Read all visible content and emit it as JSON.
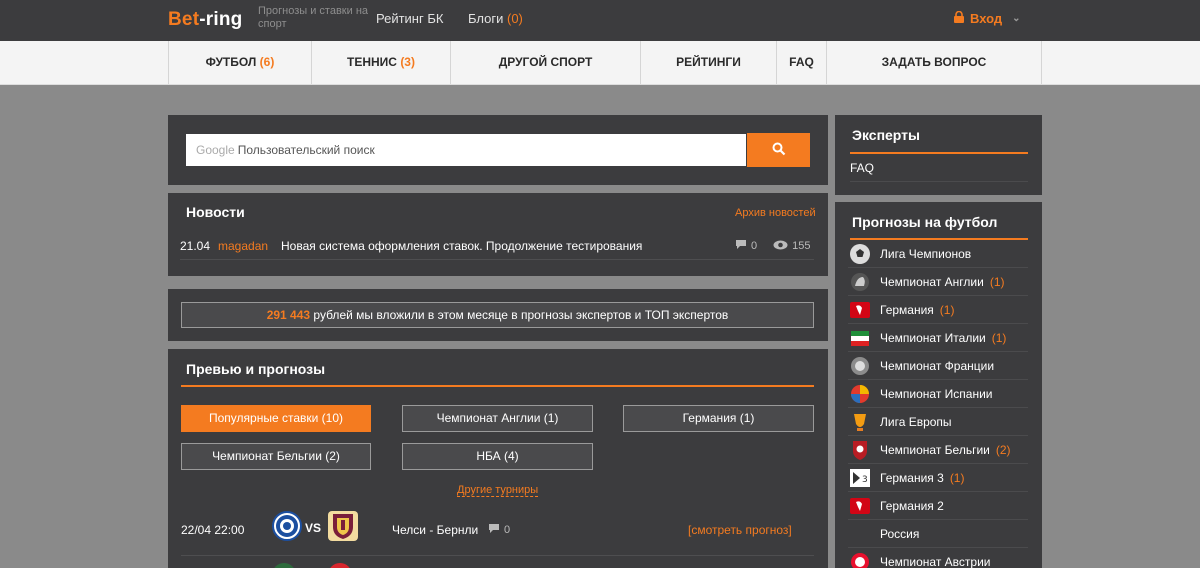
{
  "header": {
    "logo_part1": "Bet",
    "logo_part2": "-ring",
    "tagline": "Прогнозы и ставки на спорт",
    "rating_link": "Рейтинг БК",
    "blogs_link": "Блоги",
    "blogs_count": "(0)",
    "login_label": "Вход"
  },
  "nav": [
    {
      "label": "ФУТБОЛ",
      "count": "(6)"
    },
    {
      "label": "ТЕННИС",
      "count": "(3)"
    },
    {
      "label": "ДРУГОЙ СПОРТ",
      "count": ""
    },
    {
      "label": "РЕЙТИНГИ",
      "count": ""
    },
    {
      "label": "FAQ",
      "count": ""
    },
    {
      "label": "ЗАДАТЬ ВОПРОС",
      "count": ""
    }
  ],
  "search": {
    "brand": "Google",
    "placeholder": "Пользовательский поиск"
  },
  "news": {
    "title": "Новости",
    "archive_link": "Архив новостей",
    "item": {
      "date": "21.04",
      "author": "magadan",
      "title": "Новая система оформления ставок. Продолжение тестирования",
      "comments": "0",
      "views": "155"
    }
  },
  "promo": {
    "amount": "291 443",
    "text": " рублей мы вложили в этом месяце в прогнозы экспертов и ТОП экспертов"
  },
  "previews": {
    "title": "Превью и прогнозы",
    "filters": [
      {
        "label": "Популярные ставки (10)",
        "active": true
      },
      {
        "label": "Чемпионат Англии (1)",
        "active": false
      },
      {
        "label": "Германия (1)",
        "active": false
      },
      {
        "label": "Чемпионат Бельгии (2)",
        "active": false
      },
      {
        "label": "НБА (4)",
        "active": false
      }
    ],
    "more_link": "Другие турниры",
    "match": {
      "time": "22/04 22:00",
      "vs": "VS",
      "name": "Челси - Бернли",
      "comments": "0",
      "link": "[смотреть прогноз]"
    }
  },
  "sidebar": {
    "experts_title": "Эксперты",
    "experts_items": [
      "FAQ"
    ],
    "football_title": "Прогнозы на футбол",
    "football_items": [
      {
        "label": "Лига Чемпионов",
        "count": "",
        "icon": "ball-icon"
      },
      {
        "label": "Чемпионат Англии",
        "count": "(1)",
        "icon": "lion-icon"
      },
      {
        "label": "Германия",
        "count": "(1)",
        "icon": "bundesliga-icon"
      },
      {
        "label": "Чемпионат Италии",
        "count": "(1)",
        "icon": "italy-icon"
      },
      {
        "label": "Чемпионат Франции",
        "count": "",
        "icon": "france-icon"
      },
      {
        "label": "Чемпионат Испании",
        "count": "",
        "icon": "spain-icon"
      },
      {
        "label": "Лига Европы",
        "count": "",
        "icon": "europa-icon"
      },
      {
        "label": "Чемпионат Бельгии",
        "count": "(2)",
        "icon": "belgium-icon"
      },
      {
        "label": "Германия 3",
        "count": "(1)",
        "icon": "liga3-icon"
      },
      {
        "label": "Германия 2",
        "count": "",
        "icon": "bundesliga2-icon"
      },
      {
        "label": "Россия",
        "count": "",
        "icon": "russia-icon"
      },
      {
        "label": "Чемпионат Австрии",
        "count": "",
        "icon": "austria-icon"
      }
    ]
  },
  "colors": {
    "accent": "#f47b20",
    "panel": "#3c3c3e",
    "page_bg": "#8a8a8a"
  }
}
